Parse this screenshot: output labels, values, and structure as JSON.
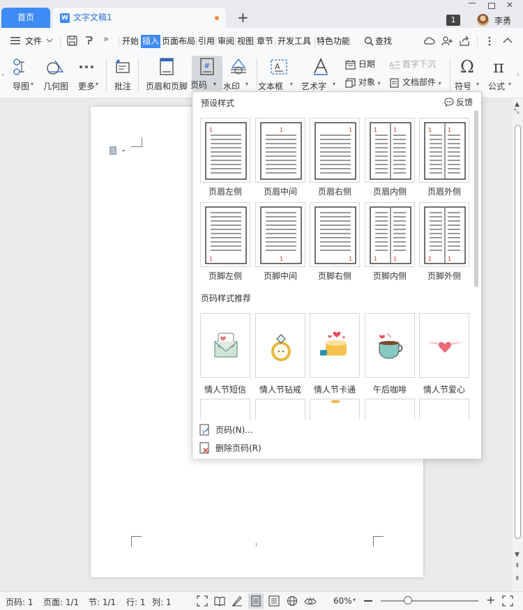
{
  "tabs": {
    "home": "首页",
    "doc": "文字文稿1",
    "new": "+"
  },
  "user": {
    "badge": "1",
    "name": "李勇"
  },
  "menu": {
    "file": "文件",
    "items": [
      "开始",
      "插入",
      "页面布局",
      "引用",
      "审阅",
      "视图",
      "章节",
      "开发工具",
      "特色功能"
    ],
    "active": "插入",
    "search": "查找"
  },
  "ribbon": {
    "smartart": "导图",
    "shapes": "几何图",
    "more": "更多",
    "comment": "批注",
    "header_footer": "页眉和页脚",
    "page_number": "页码",
    "watermark": "水印",
    "textbox": "文本框",
    "wordart": "艺术字",
    "date": "日期",
    "object": "对象",
    "dropcap": "首字下沉",
    "doc_parts": "文档部件",
    "symbol": "符号",
    "formula": "公式"
  },
  "dropdown": {
    "title": "预设样式",
    "feedback": "反馈",
    "presets": [
      {
        "label": "页眉左侧",
        "pos": "header-left"
      },
      {
        "label": "页眉中间",
        "pos": "header-center"
      },
      {
        "label": "页眉右侧",
        "pos": "header-right"
      },
      {
        "label": "页眉内侧",
        "pos": "header-inner"
      },
      {
        "label": "页眉外侧",
        "pos": "header-outer"
      },
      {
        "label": "页脚左侧",
        "pos": "footer-left"
      },
      {
        "label": "页脚中间",
        "pos": "footer-center"
      },
      {
        "label": "页脚右侧",
        "pos": "footer-right"
      },
      {
        "label": "页脚内侧",
        "pos": "footer-inner"
      },
      {
        "label": "页脚外侧",
        "pos": "footer-outer"
      }
    ],
    "page_num_digit": "1",
    "recommend_title": "页码样式推荐",
    "recommended": [
      {
        "label": "情人节短信",
        "icon": "envelope-icon"
      },
      {
        "label": "情人节钻戒",
        "icon": "ring-icon"
      },
      {
        "label": "情人节卡通",
        "icon": "cake-icon"
      },
      {
        "label": "午后咖啡",
        "icon": "coffee-icon"
      },
      {
        "label": "情人节爱心",
        "icon": "winged-heart-icon"
      }
    ],
    "page_number_item": "页码(N)...",
    "delete_item": "删除页码(R)"
  },
  "document": {
    "footer_page_number": "1"
  },
  "status": {
    "page": "页码: 1",
    "pages": "页面: 1/1",
    "section": "节: 1/1",
    "row": "行: 1",
    "col": "列: 1",
    "zoom": "60%"
  },
  "colors": {
    "accent": "#3e8bf5",
    "page_number_red": "#c0392b"
  }
}
